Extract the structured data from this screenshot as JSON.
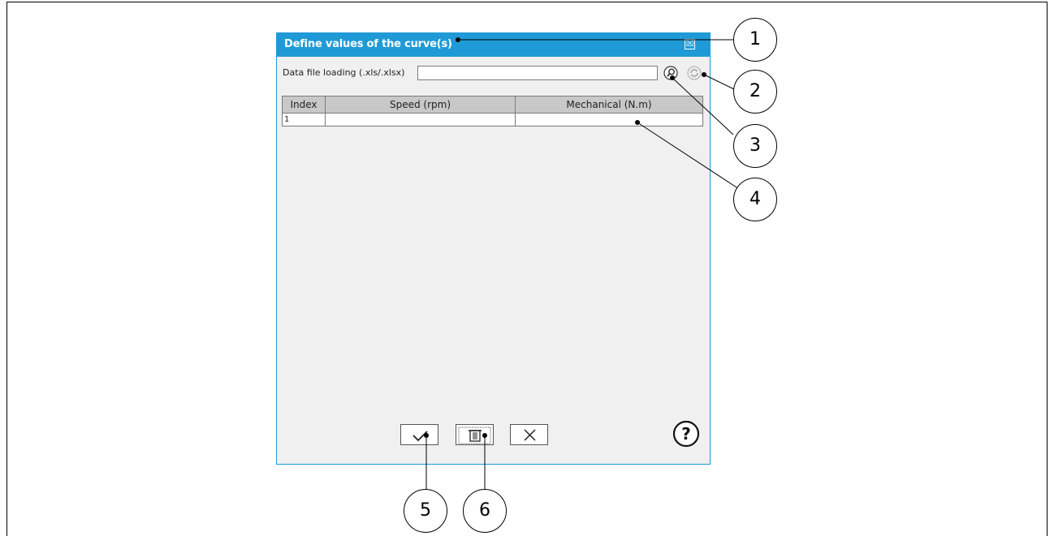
{
  "dialog": {
    "title": "Define values of the curve(s)",
    "close_symbol": "☒",
    "file_label": "Data file loading (.xls/.xlsx)",
    "file_value": "",
    "icons": {
      "browse": "magnifier-icon",
      "reload": "reload-icon",
      "validate": "checkmark-icon",
      "delete": "trash-icon",
      "cancel": "close-icon",
      "help": "help-icon"
    },
    "table": {
      "columns": [
        "Index",
        "Speed (rpm)",
        "Mechanical (N.m)"
      ],
      "rows": [
        [
          "1",
          "",
          ""
        ]
      ]
    },
    "help_label": "?"
  },
  "callouts": [
    "1",
    "2",
    "3",
    "4",
    "5",
    "6"
  ],
  "colors": {
    "accent": "#1f9ad6",
    "panel": "#f0f0f0",
    "header": "#c8c8c8"
  }
}
